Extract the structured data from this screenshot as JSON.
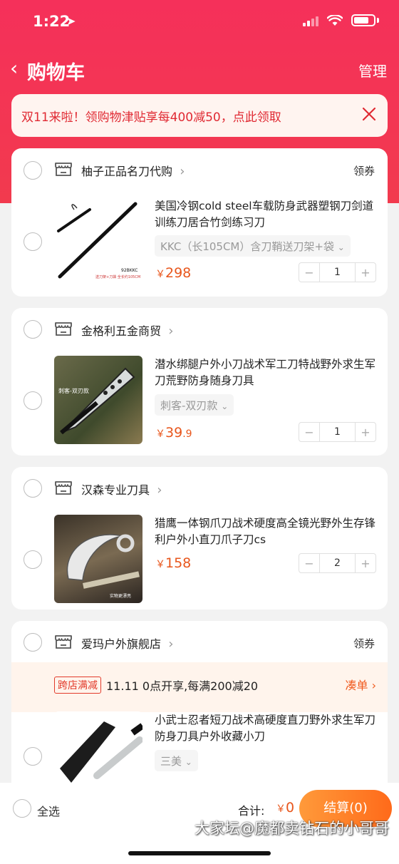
{
  "status": {
    "time": "1:22",
    "location_glyph": "➤"
  },
  "nav": {
    "back_glyph": "‹",
    "title": "购物车",
    "manage": "管理"
  },
  "promo": {
    "text": "双11来啦！领购物津贴享每400减50，点此领取"
  },
  "shops": [
    {
      "name": "柚子正品名刀代购",
      "coupon": "领券",
      "item": {
        "title": "美国冷钢cold steel车载防身武器塑钢刀剑道训练刀居合竹剑练习刀",
        "sku": "KKC（长105CM）含刀鞘送刀架+袋",
        "price_currency": "￥",
        "price_int": "298",
        "price_dec": "",
        "qty": "1",
        "image_text": "92BKKC",
        "image_caption": "送刀架+刀袋 全长约105CM"
      }
    },
    {
      "name": "金格利五金商贸",
      "coupon": "",
      "item": {
        "title": "潜水绑腿户外小刀战术军工刀特战野外求生军刀荒野防身随身刀具",
        "sku": "刺客-双刃款",
        "price_currency": "￥",
        "price_int": "39",
        "price_dec": ".9",
        "qty": "1",
        "image_text": "刺客-双刃款"
      }
    },
    {
      "name": "汉森专业刀具",
      "coupon": "",
      "item": {
        "title": "猎鹰一体钢爪刀战术硬度高全镜光野外生存锋利户外小直刀爪子刀cs",
        "sku": "",
        "price_currency": "￥",
        "price_int": "158",
        "price_dec": "",
        "qty": "2",
        "image_text": "实物更漂亮"
      }
    },
    {
      "name": "爱玛户外旗舰店",
      "coupon": "领券",
      "cross_store": {
        "tag": "跨店满减",
        "text": "11.11 0点开享,每满200减20",
        "link": "凑单"
      },
      "item": {
        "title": "小武士忍者短刀战术高硬度直刀野外求生军刀防身刀具户外收藏小刀",
        "sku": "三美",
        "price_currency": "",
        "price_int": "",
        "price_dec": "",
        "qty": ""
      }
    }
  ],
  "bottom": {
    "select_all": "全选",
    "total_label": "合计:",
    "total_currency": "￥",
    "total_value": "0",
    "checkout": "结算(0)"
  },
  "watermark": "大家坛@魔都卖钻石的小哥哥",
  "colors": {
    "hero": "#f5305a",
    "price": "#e8561c",
    "checkout_start": "#ff9a3a",
    "checkout_end": "#ff6a1a"
  }
}
